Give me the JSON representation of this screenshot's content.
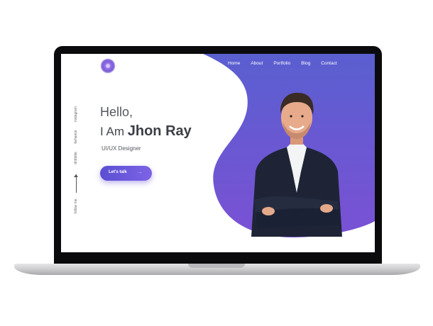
{
  "nav": {
    "items": [
      {
        "label": "Home"
      },
      {
        "label": "About"
      },
      {
        "label": "Portfolio"
      },
      {
        "label": "Blog"
      },
      {
        "label": "Contact"
      }
    ]
  },
  "social": {
    "items": [
      {
        "label": "instagram"
      },
      {
        "label": "behance"
      },
      {
        "label": "dribbble"
      },
      {
        "label": "follow me"
      }
    ]
  },
  "hero": {
    "greeting": "Hello,",
    "intro_prefix": "I Am",
    "name": "Jhon Ray",
    "role": "UI/UX Designer",
    "cta_label": "Let's talk",
    "cta_arrow": "→"
  },
  "colors": {
    "accent_start": "#5b4fd2",
    "accent_end": "#7d63e6",
    "blob_top": "#5a5fd0",
    "blob_bottom": "#7a51d4"
  },
  "icons": {
    "logo": "logo-blob-icon",
    "arrow": "arrow-right-icon",
    "follow_arrow": "arrow-up-icon"
  }
}
